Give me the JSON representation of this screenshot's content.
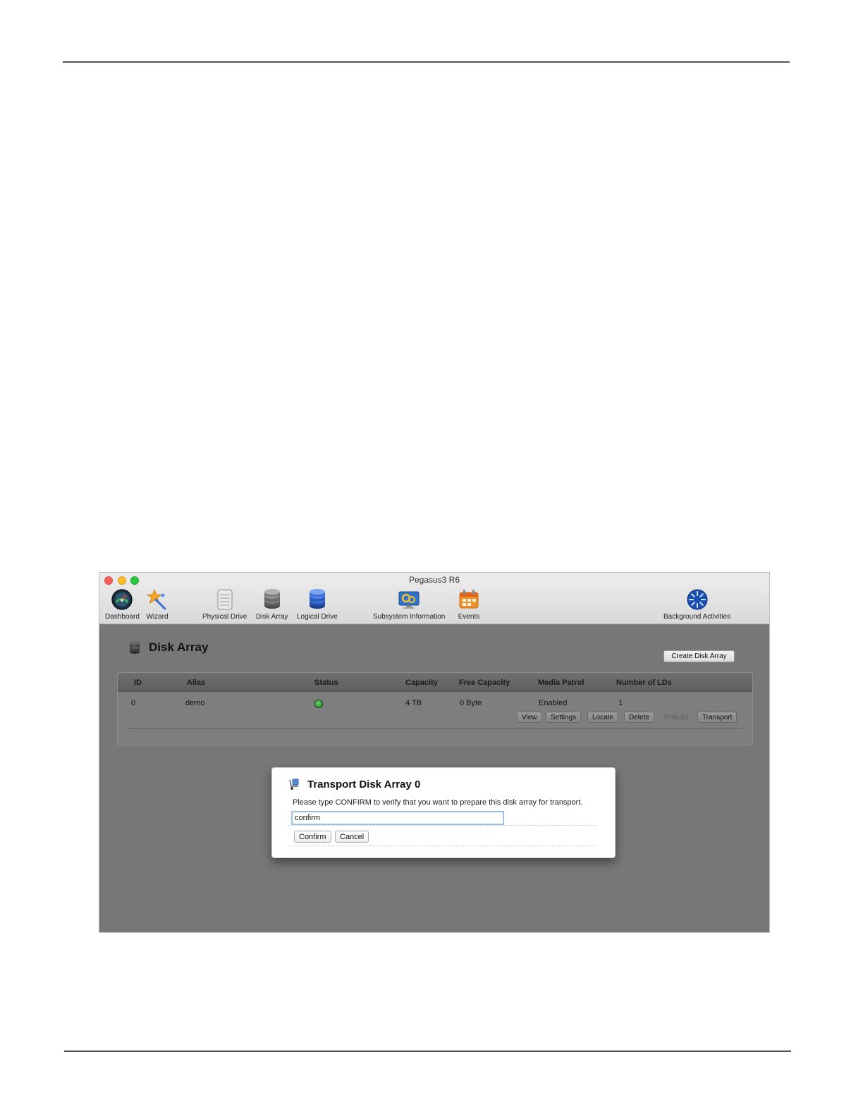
{
  "window": {
    "title": "Pegasus3 R6",
    "toolbar": [
      {
        "label": "Dashboard",
        "icon": "dashboard-gauge-icon"
      },
      {
        "label": "Wizard",
        "icon": "wizard-wand-icon"
      },
      {
        "label": "Physical Drive",
        "icon": "physical-drive-icon"
      },
      {
        "label": "Disk Array",
        "icon": "disk-array-icon"
      },
      {
        "label": "Logical Drive",
        "icon": "logical-drive-icon"
      },
      {
        "label": "Subsystem Information",
        "icon": "subsystem-info-icon"
      },
      {
        "label": "Events",
        "icon": "events-calendar-icon"
      },
      {
        "label": "Background Activities",
        "icon": "background-activities-icon"
      }
    ]
  },
  "page": {
    "title": "Disk Array",
    "create_button": "Create Disk Array"
  },
  "table": {
    "columns": [
      "ID",
      "Alias",
      "Status",
      "Capacity",
      "Free Capacity",
      "Media Patrol",
      "Number of LDs"
    ],
    "rows": [
      {
        "id": "0",
        "alias": "demo",
        "status": "ok",
        "capacity": "4 TB",
        "free_capacity": "0 Byte",
        "media_patrol": "Enabled",
        "lds": "1"
      }
    ],
    "row_actions": [
      "View",
      "Settings",
      "Locate",
      "Delete",
      "Rebuild",
      "Transport"
    ]
  },
  "dialog": {
    "title": "Transport Disk Array 0",
    "message": "Please type CONFIRM to verify that you want to prepare this disk array for transport.",
    "input_value": "confirm",
    "confirm_label": "Confirm",
    "cancel_label": "Cancel"
  },
  "colors": {
    "status_ok": "#2e9b2e",
    "content_bg": "#777777",
    "focus_ring": "#9cc3ee"
  }
}
